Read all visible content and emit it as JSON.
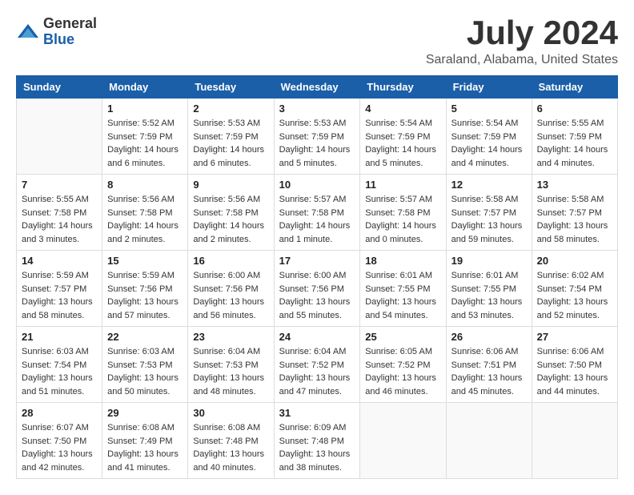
{
  "logo": {
    "general": "General",
    "blue": "Blue"
  },
  "title": {
    "month_year": "July 2024",
    "location": "Saraland, Alabama, United States"
  },
  "weekdays": [
    "Sunday",
    "Monday",
    "Tuesday",
    "Wednesday",
    "Thursday",
    "Friday",
    "Saturday"
  ],
  "weeks": [
    [
      {
        "day": "",
        "info": ""
      },
      {
        "day": "1",
        "info": "Sunrise: 5:52 AM\nSunset: 7:59 PM\nDaylight: 14 hours\nand 6 minutes."
      },
      {
        "day": "2",
        "info": "Sunrise: 5:53 AM\nSunset: 7:59 PM\nDaylight: 14 hours\nand 6 minutes."
      },
      {
        "day": "3",
        "info": "Sunrise: 5:53 AM\nSunset: 7:59 PM\nDaylight: 14 hours\nand 5 minutes."
      },
      {
        "day": "4",
        "info": "Sunrise: 5:54 AM\nSunset: 7:59 PM\nDaylight: 14 hours\nand 5 minutes."
      },
      {
        "day": "5",
        "info": "Sunrise: 5:54 AM\nSunset: 7:59 PM\nDaylight: 14 hours\nand 4 minutes."
      },
      {
        "day": "6",
        "info": "Sunrise: 5:55 AM\nSunset: 7:59 PM\nDaylight: 14 hours\nand 4 minutes."
      }
    ],
    [
      {
        "day": "7",
        "info": "Sunrise: 5:55 AM\nSunset: 7:58 PM\nDaylight: 14 hours\nand 3 minutes."
      },
      {
        "day": "8",
        "info": "Sunrise: 5:56 AM\nSunset: 7:58 PM\nDaylight: 14 hours\nand 2 minutes."
      },
      {
        "day": "9",
        "info": "Sunrise: 5:56 AM\nSunset: 7:58 PM\nDaylight: 14 hours\nand 2 minutes."
      },
      {
        "day": "10",
        "info": "Sunrise: 5:57 AM\nSunset: 7:58 PM\nDaylight: 14 hours\nand 1 minute."
      },
      {
        "day": "11",
        "info": "Sunrise: 5:57 AM\nSunset: 7:58 PM\nDaylight: 14 hours\nand 0 minutes."
      },
      {
        "day": "12",
        "info": "Sunrise: 5:58 AM\nSunset: 7:57 PM\nDaylight: 13 hours\nand 59 minutes."
      },
      {
        "day": "13",
        "info": "Sunrise: 5:58 AM\nSunset: 7:57 PM\nDaylight: 13 hours\nand 58 minutes."
      }
    ],
    [
      {
        "day": "14",
        "info": "Sunrise: 5:59 AM\nSunset: 7:57 PM\nDaylight: 13 hours\nand 58 minutes."
      },
      {
        "day": "15",
        "info": "Sunrise: 5:59 AM\nSunset: 7:56 PM\nDaylight: 13 hours\nand 57 minutes."
      },
      {
        "day": "16",
        "info": "Sunrise: 6:00 AM\nSunset: 7:56 PM\nDaylight: 13 hours\nand 56 minutes."
      },
      {
        "day": "17",
        "info": "Sunrise: 6:00 AM\nSunset: 7:56 PM\nDaylight: 13 hours\nand 55 minutes."
      },
      {
        "day": "18",
        "info": "Sunrise: 6:01 AM\nSunset: 7:55 PM\nDaylight: 13 hours\nand 54 minutes."
      },
      {
        "day": "19",
        "info": "Sunrise: 6:01 AM\nSunset: 7:55 PM\nDaylight: 13 hours\nand 53 minutes."
      },
      {
        "day": "20",
        "info": "Sunrise: 6:02 AM\nSunset: 7:54 PM\nDaylight: 13 hours\nand 52 minutes."
      }
    ],
    [
      {
        "day": "21",
        "info": "Sunrise: 6:03 AM\nSunset: 7:54 PM\nDaylight: 13 hours\nand 51 minutes."
      },
      {
        "day": "22",
        "info": "Sunrise: 6:03 AM\nSunset: 7:53 PM\nDaylight: 13 hours\nand 50 minutes."
      },
      {
        "day": "23",
        "info": "Sunrise: 6:04 AM\nSunset: 7:53 PM\nDaylight: 13 hours\nand 48 minutes."
      },
      {
        "day": "24",
        "info": "Sunrise: 6:04 AM\nSunset: 7:52 PM\nDaylight: 13 hours\nand 47 minutes."
      },
      {
        "day": "25",
        "info": "Sunrise: 6:05 AM\nSunset: 7:52 PM\nDaylight: 13 hours\nand 46 minutes."
      },
      {
        "day": "26",
        "info": "Sunrise: 6:06 AM\nSunset: 7:51 PM\nDaylight: 13 hours\nand 45 minutes."
      },
      {
        "day": "27",
        "info": "Sunrise: 6:06 AM\nSunset: 7:50 PM\nDaylight: 13 hours\nand 44 minutes."
      }
    ],
    [
      {
        "day": "28",
        "info": "Sunrise: 6:07 AM\nSunset: 7:50 PM\nDaylight: 13 hours\nand 42 minutes."
      },
      {
        "day": "29",
        "info": "Sunrise: 6:08 AM\nSunset: 7:49 PM\nDaylight: 13 hours\nand 41 minutes."
      },
      {
        "day": "30",
        "info": "Sunrise: 6:08 AM\nSunset: 7:48 PM\nDaylight: 13 hours\nand 40 minutes."
      },
      {
        "day": "31",
        "info": "Sunrise: 6:09 AM\nSunset: 7:48 PM\nDaylight: 13 hours\nand 38 minutes."
      },
      {
        "day": "",
        "info": ""
      },
      {
        "day": "",
        "info": ""
      },
      {
        "day": "",
        "info": ""
      }
    ]
  ]
}
